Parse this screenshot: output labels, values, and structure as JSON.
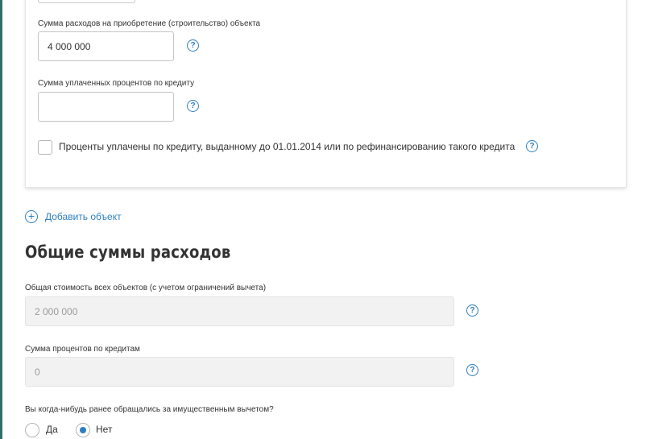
{
  "object_card": {
    "cost_label": "Сумма расходов на приобретение (строительство) объекта",
    "cost_value": "4 000 000",
    "interest_label": "Сумма уплаченных процентов по кредиту",
    "interest_value": "",
    "pre2014_checkbox_label": "Проценты уплачены по кредиту, выданному до 01.01.2014 или по рефинансированию такого кредита",
    "pre2014_checked": false,
    "help_glyph": "?"
  },
  "add_object": {
    "icon": "plus-circle-icon",
    "icon_glyph": "+",
    "label": "Добавить объект"
  },
  "totals": {
    "title": "Общие суммы расходов",
    "total_cost_label": "Общая стоимость всех объектов (с учетом ограничений вычета)",
    "total_cost_value": "2 000 000",
    "total_interest_label": "Сумма процентов по кредитам",
    "total_interest_value": "0"
  },
  "previous_deduction": {
    "question": "Вы когда-нибудь ранее обращались за имущественным вычетом?",
    "options": [
      {
        "label": "Да",
        "selected": false
      },
      {
        "label": "Нет",
        "selected": true
      }
    ]
  },
  "colors": {
    "accent": "#2e7fbf",
    "left_rule": "#2f6f6a",
    "disabled_field": "#f2f2f2"
  }
}
